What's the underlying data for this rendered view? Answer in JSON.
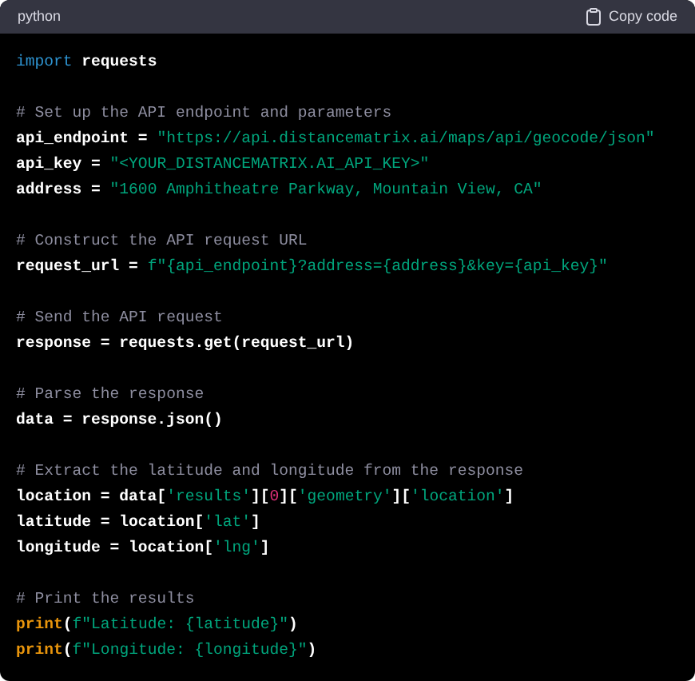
{
  "header": {
    "language": "python",
    "copy_label": "Copy code"
  },
  "blocks": [
    [
      [
        {
          "kind": "keyword",
          "text": "import"
        },
        {
          "kind": "plain",
          "text": " requests"
        }
      ]
    ],
    [
      [
        {
          "kind": "comment",
          "text": "# Set up the API endpoint and parameters"
        }
      ],
      [
        {
          "kind": "plain",
          "text": "api_endpoint = "
        },
        {
          "kind": "string",
          "text": "\"https://api.distancematrix.ai/maps/api/geocode/json\""
        }
      ],
      [
        {
          "kind": "plain",
          "text": "api_key = "
        },
        {
          "kind": "string",
          "text": "\"<YOUR_DISTANCEMATRIX.AI_API_KEY>\""
        }
      ],
      [
        {
          "kind": "plain",
          "text": "address = "
        },
        {
          "kind": "string",
          "text": "\"1600 Amphitheatre Parkway, Mountain View, CA\""
        }
      ]
    ],
    [
      [
        {
          "kind": "comment",
          "text": "# Construct the API request URL"
        }
      ],
      [
        {
          "kind": "plain",
          "text": "request_url = "
        },
        {
          "kind": "string",
          "text": "f\"{api_endpoint}?address={address}&key={api_key}\""
        }
      ]
    ],
    [
      [
        {
          "kind": "comment",
          "text": "# Send the API request"
        }
      ],
      [
        {
          "kind": "plain",
          "text": "response = requests.get(request_url)"
        }
      ]
    ],
    [
      [
        {
          "kind": "comment",
          "text": "# Parse the response"
        }
      ],
      [
        {
          "kind": "plain",
          "text": "data = response.json()"
        }
      ]
    ],
    [
      [
        {
          "kind": "comment",
          "text": "# Extract the latitude and longitude from the response"
        }
      ],
      [
        {
          "kind": "plain",
          "text": "location = data["
        },
        {
          "kind": "string",
          "text": "'results'"
        },
        {
          "kind": "plain",
          "text": "]["
        },
        {
          "kind": "number",
          "text": "0"
        },
        {
          "kind": "plain",
          "text": "]["
        },
        {
          "kind": "string",
          "text": "'geometry'"
        },
        {
          "kind": "plain",
          "text": "]["
        },
        {
          "kind": "string",
          "text": "'location'"
        },
        {
          "kind": "plain",
          "text": "]"
        }
      ],
      [
        {
          "kind": "plain",
          "text": "latitude = location["
        },
        {
          "kind": "string",
          "text": "'lat'"
        },
        {
          "kind": "plain",
          "text": "]"
        }
      ],
      [
        {
          "kind": "plain",
          "text": "longitude = location["
        },
        {
          "kind": "string",
          "text": "'lng'"
        },
        {
          "kind": "plain",
          "text": "]"
        }
      ]
    ],
    [
      [
        {
          "kind": "comment",
          "text": "# Print the results"
        }
      ],
      [
        {
          "kind": "builtin",
          "text": "print"
        },
        {
          "kind": "plain",
          "text": "("
        },
        {
          "kind": "string",
          "text": "f\"Latitude: {latitude}\""
        },
        {
          "kind": "plain",
          "text": ")"
        }
      ],
      [
        {
          "kind": "builtin",
          "text": "print"
        },
        {
          "kind": "plain",
          "text": "("
        },
        {
          "kind": "string",
          "text": "f\"Longitude: {longitude}\""
        },
        {
          "kind": "plain",
          "text": ")"
        }
      ]
    ]
  ]
}
